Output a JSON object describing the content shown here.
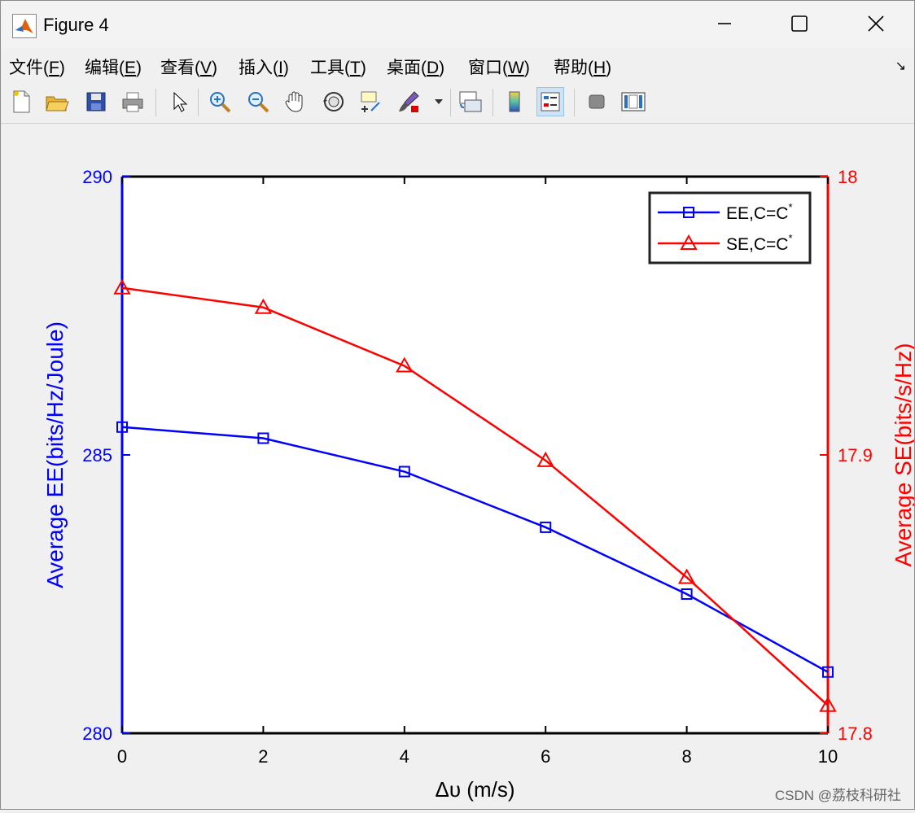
{
  "window": {
    "title": "Figure 4"
  },
  "menu": [
    "文件(F)",
    "编辑(E)",
    "查看(V)",
    "插入(I)",
    "工具(T)",
    "桌面(D)",
    "窗口(W)",
    "帮助(H)"
  ],
  "menu_keys": [
    "F",
    "E",
    "V",
    "I",
    "T",
    "D",
    "W",
    "H"
  ],
  "toolbar_icons": [
    "new-figure-icon",
    "open-file-icon",
    "save-icon",
    "print-icon",
    "pointer-icon",
    "zoom-in-icon",
    "zoom-out-icon",
    "pan-hand-icon",
    "rotate-3d-icon",
    "data-cursor-icon",
    "brush-icon",
    "link-plot-icon",
    "colorbar-icon",
    "legend-icon",
    "hide-plot-tools-icon",
    "show-plot-tools-icon"
  ],
  "chart_data": {
    "type": "line",
    "x": [
      0,
      2,
      4,
      6,
      8,
      10
    ],
    "xlabel": "Δυ (m/s)",
    "xlim": [
      0,
      10
    ],
    "xticks": [
      "0",
      "2",
      "4",
      "6",
      "8",
      "10"
    ],
    "left_axis": {
      "label": "Average EE(bits/Hz/Joule)",
      "lim": [
        280,
        290
      ],
      "ticks": [
        "280",
        "285",
        "290"
      ],
      "color": "#0000ff"
    },
    "right_axis": {
      "label": "Average SE(bits/s/Hz)",
      "lim": [
        17.8,
        18.0
      ],
      "ticks": [
        "17.8",
        "17.9",
        "18"
      ],
      "color": "#ff0000"
    },
    "series": [
      {
        "name": "EE,C=C*",
        "axis": "left",
        "color": "#0000ff",
        "marker": "square",
        "values": [
          285.5,
          285.3,
          284.7,
          283.7,
          282.5,
          281.1
        ]
      },
      {
        "name": "SE,C=C*",
        "axis": "right",
        "color": "#ff0000",
        "marker": "triangle",
        "values": [
          17.96,
          17.953,
          17.932,
          17.898,
          17.856,
          17.81
        ]
      }
    ],
    "legend_position": "top-right",
    "grid": false
  },
  "watermark": "CSDN @荔枝科研社"
}
